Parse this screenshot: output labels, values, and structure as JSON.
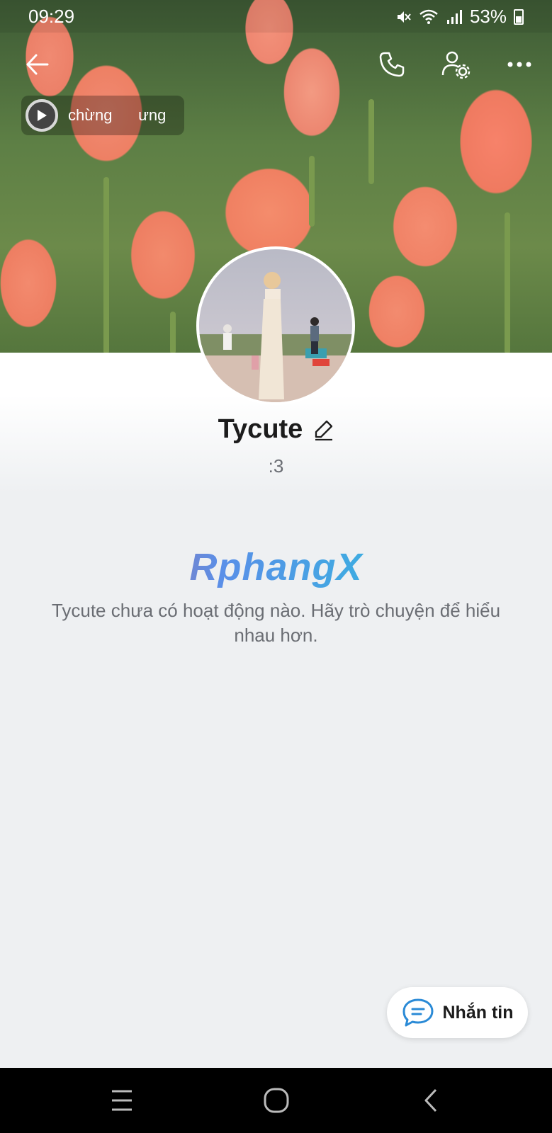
{
  "status_bar": {
    "time": "09:29",
    "battery": "53%",
    "icons": [
      "mute-icon",
      "wifi-icon",
      "signal-icon",
      "battery-icon"
    ]
  },
  "header": {
    "icons": [
      "back-arrow-icon",
      "phone-icon",
      "user-settings-icon",
      "more-icon"
    ]
  },
  "music": {
    "text": "chừng      ưng"
  },
  "profile": {
    "name": "Tycute",
    "status": ":3"
  },
  "watermark": "RphangX",
  "empty_state": {
    "message": "Tycute chưa có hoạt động nào. Hãy trò chuyện để hiểu nhau hơn."
  },
  "message_button": {
    "label": "Nhắn tin",
    "icon": "chat-bubble-icon"
  },
  "nav": {
    "icons": [
      "recent-apps-icon",
      "home-icon",
      "back-icon"
    ]
  },
  "colors": {
    "accent": "#2a8ad6",
    "background": "#eef0f2",
    "text_primary": "#1c1c1c",
    "text_secondary": "#6a6d73"
  }
}
